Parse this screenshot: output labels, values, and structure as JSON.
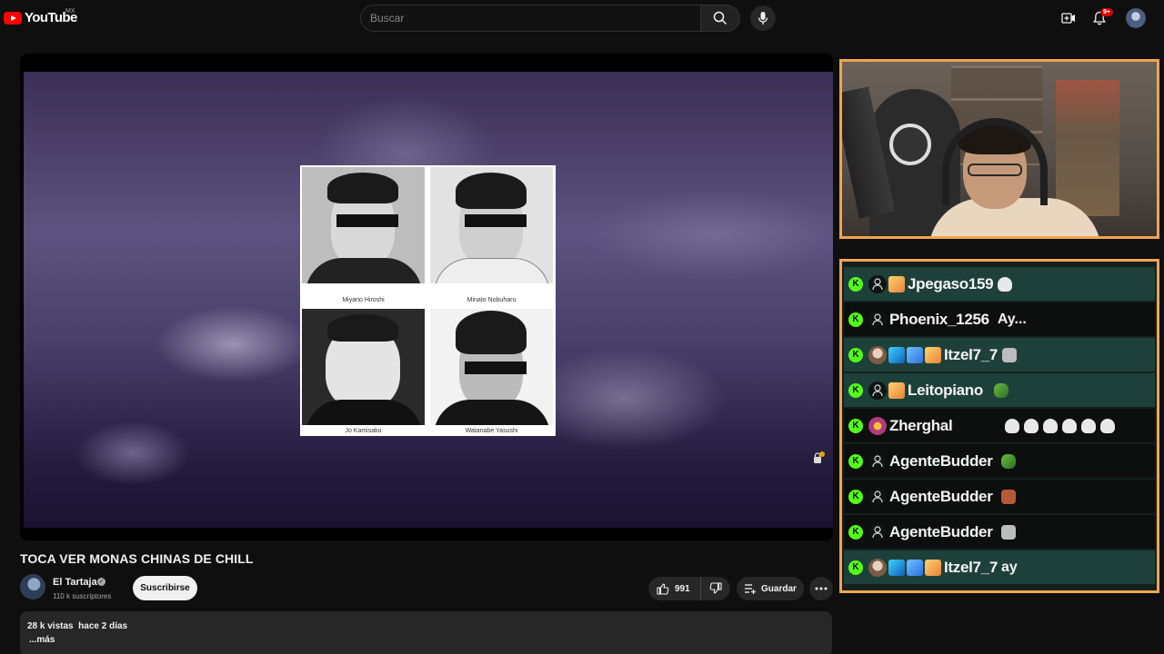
{
  "topbar": {
    "logo_text": "YouTube",
    "country": "MX",
    "search_placeholder": "Buscar",
    "notifications_badge": "9+"
  },
  "video": {
    "captions": [
      "Miyano Hiroshi",
      "Minato Nobuharu",
      "Jo Kamisaku",
      "Watanabe Yasushi"
    ]
  },
  "title": "TOCA VER MONAS CHINAS DE CHILL",
  "channel": {
    "name": "El Tartaja",
    "subscribers": "110 k suscriptores",
    "subscribe_label": "Suscribirse"
  },
  "actions": {
    "likes": "991",
    "save_label": "Guardar"
  },
  "description": {
    "views": "28 k vistas",
    "date": "hace 2 días",
    "more": "...más"
  },
  "chat": {
    "messages": [
      {
        "user": "Jpegaso159",
        "text": ""
      },
      {
        "user": "Phoenix_1256",
        "text": "Ay..."
      },
      {
        "user": "Itzel7_7",
        "text": ""
      },
      {
        "user": "Leitopiano",
        "text": ""
      },
      {
        "user": "Zherghal",
        "text": ""
      },
      {
        "user": "AgenteBudder",
        "text": ""
      },
      {
        "user": "AgenteBudder",
        "text": ""
      },
      {
        "user": "AgenteBudder",
        "text": ""
      },
      {
        "user": "Itzel7_7",
        "text": "ay"
      }
    ]
  },
  "colors": {
    "accent": "#f2a44f",
    "brand": "#ff0000",
    "kick": "#53fc18",
    "chat_row": "#1e403a"
  }
}
